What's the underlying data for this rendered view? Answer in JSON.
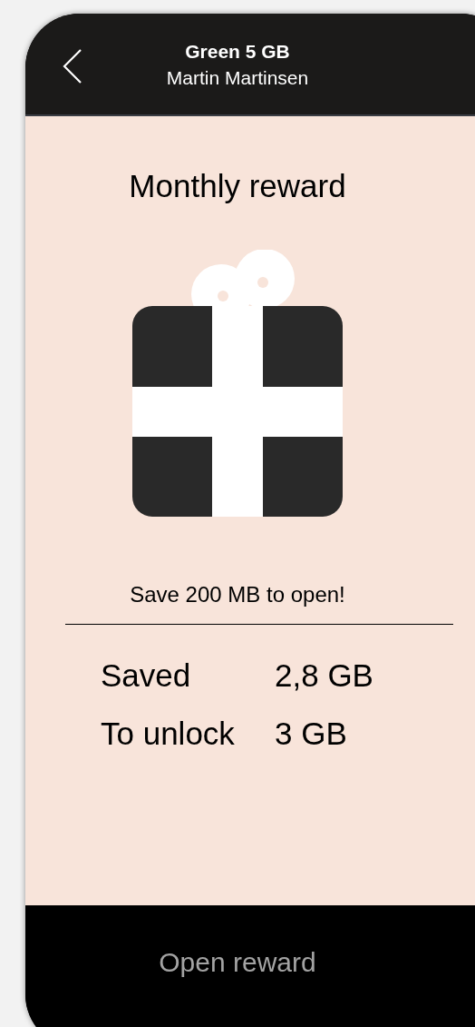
{
  "header": {
    "title": "Green 5 GB",
    "subtitle": "Martin Martinsen"
  },
  "reward": {
    "title": "Monthly reward",
    "hint": "Save 200 MB to open!",
    "stats": [
      {
        "label": "Saved",
        "value": "2,8 GB"
      },
      {
        "label": "To unlock",
        "value": "3 GB"
      }
    ]
  },
  "action": {
    "label": "Open reward",
    "disabled": true
  }
}
